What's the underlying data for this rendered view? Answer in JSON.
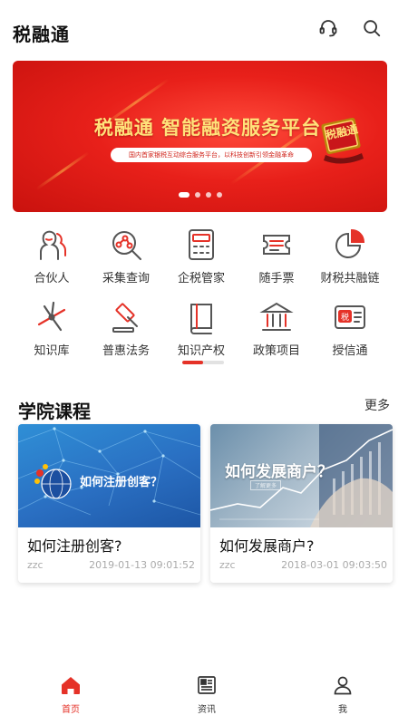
{
  "app": {
    "title": "税融通"
  },
  "banner": {
    "title": "税融通 智能融资服务平台",
    "subtitle": "国内首家银税互动综合服务平台，以科技创新引领金融革命",
    "seal_text": "税融通",
    "slides": 4,
    "active_slide": 0
  },
  "grid": {
    "items": [
      {
        "label": "合伙人",
        "icon": "partner-icon"
      },
      {
        "label": "采集查询",
        "icon": "query-icon"
      },
      {
        "label": "企税管家",
        "icon": "calculator-icon"
      },
      {
        "label": "随手票",
        "icon": "ticket-icon"
      },
      {
        "label": "财税共融链",
        "icon": "pie-chart-icon"
      },
      {
        "label": "知识库",
        "icon": "pinwheel-icon"
      },
      {
        "label": "普惠法务",
        "icon": "gavel-icon"
      },
      {
        "label": "知识产权",
        "icon": "book-icon"
      },
      {
        "label": "政策项目",
        "icon": "bank-icon"
      },
      {
        "label": "授信通",
        "icon": "tax-card-icon"
      }
    ],
    "page_indicator": {
      "pages": 2,
      "active": 0
    }
  },
  "academy": {
    "title": "学院课程",
    "more_label": "更多",
    "courses": [
      {
        "image_text": "如何注册创客？",
        "title": "如何注册创客?",
        "author": "zzc",
        "date": "2019-01-13 09:01:52"
      },
      {
        "image_text": "如何发展商户？",
        "image_subtext": "了解更多",
        "title": "如何发展商户?",
        "author": "zzc",
        "date": "2018-03-01 09:03:50"
      }
    ]
  },
  "tabbar": {
    "tabs": [
      {
        "label": "首页",
        "icon": "home-icon",
        "active": true
      },
      {
        "label": "资讯",
        "icon": "news-icon",
        "active": false
      },
      {
        "label": "我",
        "icon": "user-icon",
        "active": false
      }
    ]
  },
  "colors": {
    "accent": "#e53228",
    "banner_red": "#e8201a",
    "banner_gold": "#ffe27a",
    "icon_gray": "#555555"
  }
}
